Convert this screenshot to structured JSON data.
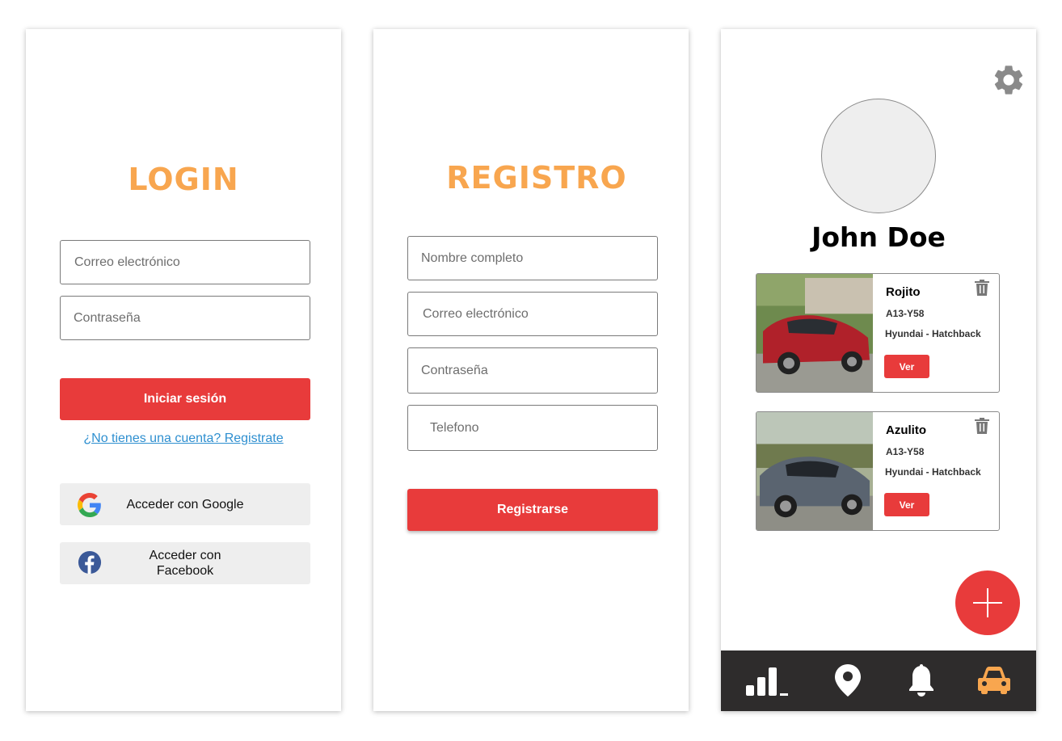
{
  "login": {
    "title": "LOGIN",
    "email_placeholder": "Correo electrónico",
    "password_placeholder": "Contraseña",
    "submit_label": "Iniciar sesión",
    "register_link": "¿No tienes una cuenta? Registrate",
    "google_label": "Acceder con Google",
    "facebook_label": "Acceder con Facebook",
    "google_icon": "google-icon",
    "facebook_icon": "facebook-icon"
  },
  "registro": {
    "title": "REGISTRO",
    "name_placeholder": "Nombre completo",
    "email_placeholder": "Correo electrónico",
    "password_placeholder": "Contraseña",
    "phone_placeholder": "Telefono",
    "submit_label": "Registrarse"
  },
  "perfil": {
    "user_name": "John Doe",
    "cars": [
      {
        "name": "Rojito",
        "plate": "A13-Y58",
        "model": "Hyundai - Hatchback",
        "view_label": "Ver",
        "color": "#B0212A"
      },
      {
        "name": "Azulito",
        "plate": "A13-Y58",
        "model": "Hyundai - Hatchback",
        "view_label": "Ver",
        "color": "#5A6470"
      }
    ],
    "nav": [
      "stats-icon",
      "location-pin-icon",
      "bell-icon",
      "car-icon"
    ],
    "nav_active": "car-icon"
  },
  "colors": {
    "accent_orange": "#F8A64F",
    "primary_red": "#E83B3B",
    "link_blue": "#2E8FD0",
    "navbar_bg": "#2E2C2C"
  }
}
